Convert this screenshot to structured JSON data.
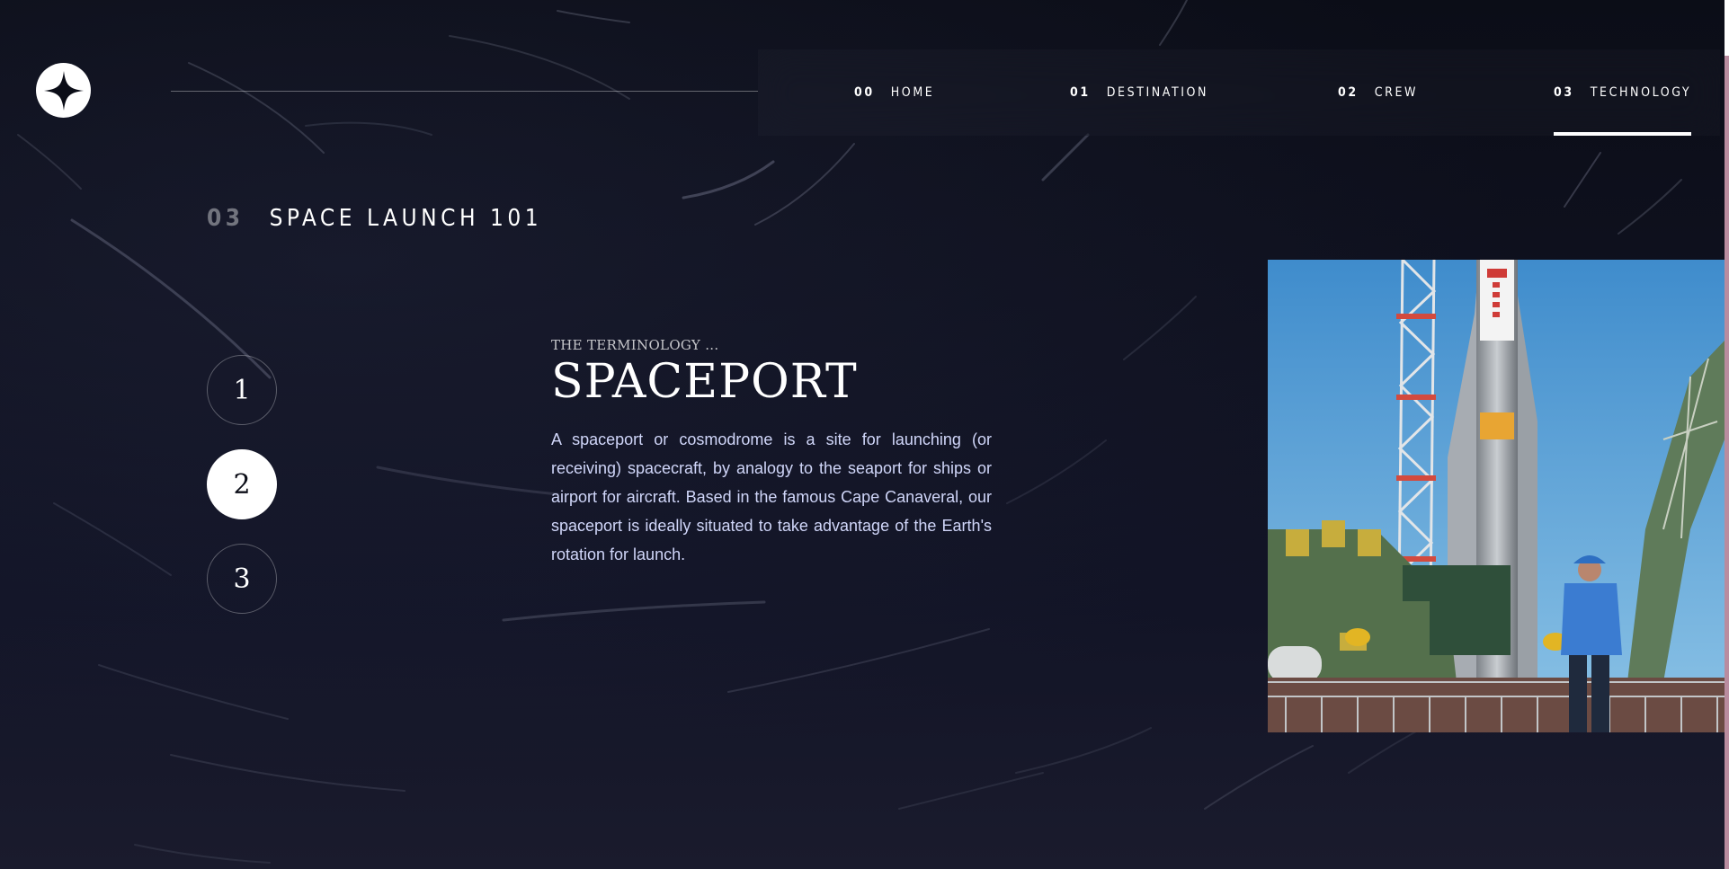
{
  "nav": {
    "items": [
      {
        "num": "00",
        "label": "HOME"
      },
      {
        "num": "01",
        "label": "DESTINATION"
      },
      {
        "num": "02",
        "label": "CREW"
      },
      {
        "num": "03",
        "label": "TECHNOLOGY"
      }
    ],
    "active_index": 3
  },
  "page": {
    "heading_num": "03",
    "heading_label": "SPACE LAUNCH 101"
  },
  "steps": {
    "items": [
      "1",
      "2",
      "3"
    ],
    "active_index": 1
  },
  "content": {
    "eyebrow": "THE TERMINOLOGY ...",
    "title": "SPACEPORT",
    "body": "A spaceport or cosmodrome is a site for launching (or receiving) spacecraft, by analogy to the seaport for ships or airport for aircraft. Based in the famous Cape Canaveral, our spaceport is ideally situated to take advantage of the Earth's rotation for launch."
  },
  "image": {
    "subject": "rocket-launch-pad-photo"
  },
  "colors": {
    "background": "#0b0d17",
    "accent": "#ffffff",
    "body_text": "#d0d6f9"
  }
}
